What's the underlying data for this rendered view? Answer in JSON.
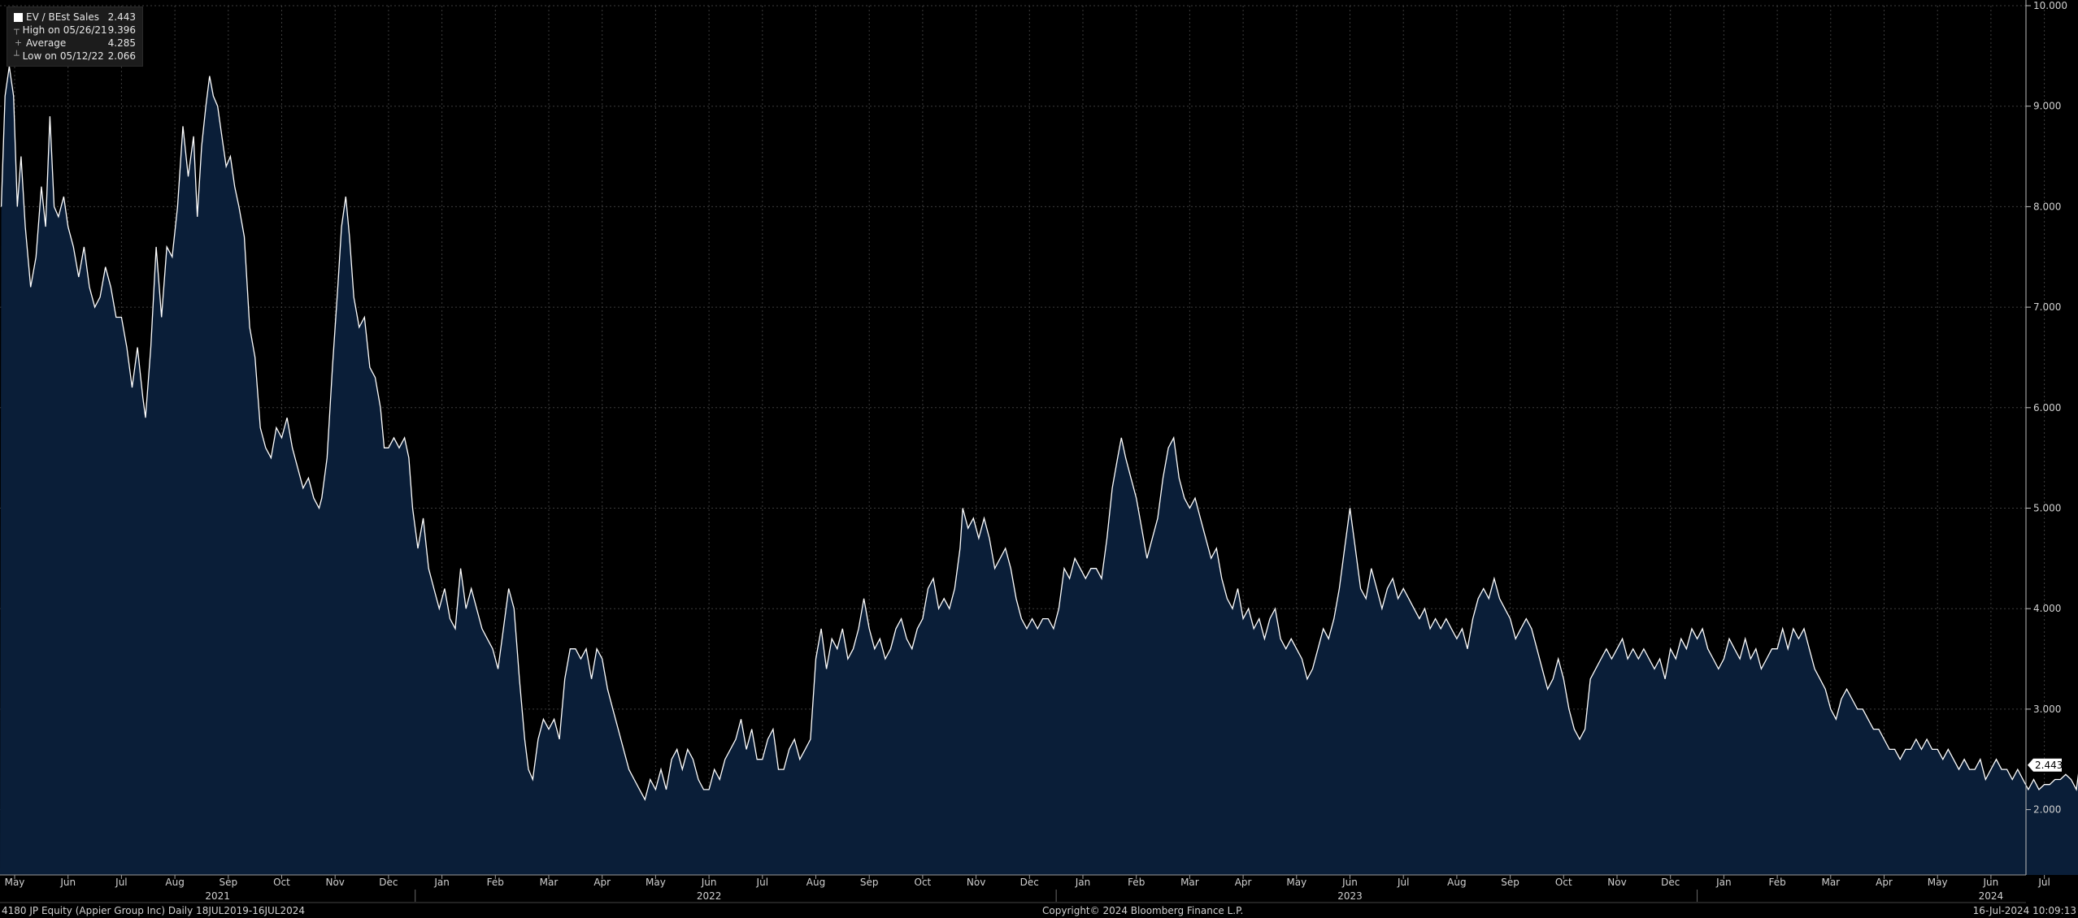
{
  "legend": {
    "items": [
      {
        "label": "EV / BEst Sales",
        "value": "2.443"
      },
      {
        "label": "High on 05/26/21",
        "value": "9.396"
      },
      {
        "label": "Average",
        "value": "4.285"
      },
      {
        "label": "Low on 05/12/22",
        "value": "2.066"
      }
    ]
  },
  "footer": {
    "left": "4180 JP Equity (Appier Group Inc)  Daily 18JUL2019-16JUL2024",
    "center": "Copyright© 2024 Bloomberg Finance L.P.",
    "right": "16-Jul-2024 10:09:13"
  },
  "last_value_label": "2.443",
  "colors": {
    "background": "#000000",
    "area": "#0a1e38",
    "line": "#ffffff",
    "grid": "#3c3c3c"
  },
  "chart_data": {
    "type": "area",
    "series": [
      {
        "name": "EV / BEst Sales"
      }
    ],
    "ylim": [
      1.35,
      10.0
    ],
    "y_ticks": [
      "2.000",
      "3.000",
      "4.000",
      "5.000",
      "6.000",
      "7.000",
      "8.000",
      "9.000",
      "10.000"
    ],
    "y_tick_values": [
      2,
      3,
      4,
      5,
      6,
      7,
      8,
      9,
      10
    ],
    "x_month_labels": [
      "May",
      "Jun",
      "Jul",
      "Aug",
      "Sep",
      "Oct",
      "Nov",
      "Dec",
      "Jan",
      "Feb",
      "Mar",
      "Apr",
      "May",
      "Jun",
      "Jul",
      "Aug",
      "Sep",
      "Oct",
      "Nov",
      "Dec",
      "Jan",
      "Feb",
      "Mar",
      "Apr",
      "May",
      "Jun",
      "Jul",
      "Aug",
      "Sep",
      "Oct",
      "Nov",
      "Dec",
      "Jan",
      "Feb",
      "Mar",
      "Apr",
      "May",
      "Jun",
      "Jul",
      "Aug",
      "Sep",
      "Oct",
      "Nov",
      "Dec",
      "Jan",
      "Feb",
      "Mar",
      "Apr",
      "May",
      "Jun",
      "Jul"
    ],
    "x_month_index": [
      0,
      1,
      2,
      3,
      4,
      5,
      6,
      7,
      8,
      9,
      10,
      11,
      12,
      13,
      14,
      15,
      16,
      17,
      18,
      19,
      20,
      21,
      22,
      23,
      24,
      25,
      26,
      27,
      28,
      29,
      30,
      31,
      32,
      33,
      34,
      35,
      36,
      37,
      38,
      39,
      40,
      41,
      42,
      43,
      44,
      45,
      46,
      47,
      48,
      49,
      50
    ],
    "x_year_labels": [
      {
        "label": "2021",
        "at_month_index": 3.8
      },
      {
        "label": "2022",
        "at_month_index": 13
      },
      {
        "label": "2023",
        "at_month_index": 25
      },
      {
        "label": "2024",
        "at_month_index": 37
      }
    ],
    "year_dividers_after_month_index": [
      7.5,
      19.5,
      31.5,
      43.5
    ],
    "points_by_month_index": [
      [
        -0.25,
        8.0
      ],
      [
        -0.18,
        9.1
      ],
      [
        -0.1,
        9.396
      ],
      [
        -0.02,
        9.1
      ],
      [
        0.05,
        8.0
      ],
      [
        0.12,
        8.5
      ],
      [
        0.2,
        7.8
      ],
      [
        0.3,
        7.2
      ],
      [
        0.4,
        7.5
      ],
      [
        0.5,
        8.2
      ],
      [
        0.58,
        7.8
      ],
      [
        0.66,
        8.9
      ],
      [
        0.74,
        8.0
      ],
      [
        0.82,
        7.9
      ],
      [
        0.92,
        8.1
      ],
      [
        1.0,
        7.8
      ],
      [
        1.1,
        7.6
      ],
      [
        1.2,
        7.3
      ],
      [
        1.3,
        7.6
      ],
      [
        1.4,
        7.2
      ],
      [
        1.5,
        7.0
      ],
      [
        1.6,
        7.1
      ],
      [
        1.7,
        7.4
      ],
      [
        1.8,
        7.2
      ],
      [
        1.9,
        6.9
      ],
      [
        2.0,
        6.9
      ],
      [
        2.1,
        6.6
      ],
      [
        2.2,
        6.2
      ],
      [
        2.3,
        6.6
      ],
      [
        2.4,
        6.1
      ],
      [
        2.45,
        5.9
      ],
      [
        2.55,
        6.6
      ],
      [
        2.65,
        7.6
      ],
      [
        2.75,
        6.9
      ],
      [
        2.85,
        7.6
      ],
      [
        2.95,
        7.5
      ],
      [
        3.05,
        8.0
      ],
      [
        3.15,
        8.8
      ],
      [
        3.25,
        8.3
      ],
      [
        3.35,
        8.7
      ],
      [
        3.42,
        7.9
      ],
      [
        3.5,
        8.6
      ],
      [
        3.58,
        9.0
      ],
      [
        3.65,
        9.3
      ],
      [
        3.72,
        9.1
      ],
      [
        3.8,
        9.0
      ],
      [
        3.88,
        8.7
      ],
      [
        3.96,
        8.4
      ],
      [
        4.04,
        8.5
      ],
      [
        4.12,
        8.2
      ],
      [
        4.2,
        8.0
      ],
      [
        4.3,
        7.7
      ],
      [
        4.4,
        6.8
      ],
      [
        4.5,
        6.5
      ],
      [
        4.6,
        5.8
      ],
      [
        4.7,
        5.6
      ],
      [
        4.8,
        5.5
      ],
      [
        4.9,
        5.8
      ],
      [
        5.0,
        5.7
      ],
      [
        5.1,
        5.9
      ],
      [
        5.2,
        5.6
      ],
      [
        5.3,
        5.4
      ],
      [
        5.4,
        5.2
      ],
      [
        5.5,
        5.3
      ],
      [
        5.6,
        5.1
      ],
      [
        5.7,
        5.0
      ],
      [
        5.75,
        5.1
      ],
      [
        5.85,
        5.5
      ],
      [
        5.95,
        6.4
      ],
      [
        6.05,
        7.2
      ],
      [
        6.12,
        7.8
      ],
      [
        6.2,
        8.1
      ],
      [
        6.27,
        7.7
      ],
      [
        6.35,
        7.1
      ],
      [
        6.45,
        6.8
      ],
      [
        6.55,
        6.9
      ],
      [
        6.65,
        6.4
      ],
      [
        6.75,
        6.3
      ],
      [
        6.85,
        6.0
      ],
      [
        6.92,
        5.6
      ],
      [
        7.0,
        5.6
      ],
      [
        7.1,
        5.7
      ],
      [
        7.2,
        5.6
      ],
      [
        7.3,
        5.7
      ],
      [
        7.38,
        5.5
      ],
      [
        7.45,
        5.0
      ],
      [
        7.55,
        4.6
      ],
      [
        7.65,
        4.9
      ],
      [
        7.75,
        4.4
      ],
      [
        7.85,
        4.2
      ],
      [
        7.95,
        4.0
      ],
      [
        8.05,
        4.2
      ],
      [
        8.15,
        3.9
      ],
      [
        8.25,
        3.8
      ],
      [
        8.35,
        4.4
      ],
      [
        8.45,
        4.0
      ],
      [
        8.55,
        4.2
      ],
      [
        8.65,
        4.0
      ],
      [
        8.75,
        3.8
      ],
      [
        8.85,
        3.7
      ],
      [
        8.95,
        3.6
      ],
      [
        9.05,
        3.4
      ],
      [
        9.15,
        3.8
      ],
      [
        9.25,
        4.2
      ],
      [
        9.35,
        4.0
      ],
      [
        9.45,
        3.3
      ],
      [
        9.55,
        2.7
      ],
      [
        9.62,
        2.4
      ],
      [
        9.7,
        2.3
      ],
      [
        9.8,
        2.7
      ],
      [
        9.9,
        2.9
      ],
      [
        10.0,
        2.8
      ],
      [
        10.1,
        2.9
      ],
      [
        10.2,
        2.7
      ],
      [
        10.3,
        3.3
      ],
      [
        10.4,
        3.6
      ],
      [
        10.5,
        3.6
      ],
      [
        10.6,
        3.5
      ],
      [
        10.7,
        3.6
      ],
      [
        10.8,
        3.3
      ],
      [
        10.9,
        3.6
      ],
      [
        11.0,
        3.5
      ],
      [
        11.1,
        3.2
      ],
      [
        11.2,
        3.0
      ],
      [
        11.3,
        2.8
      ],
      [
        11.4,
        2.6
      ],
      [
        11.5,
        2.4
      ],
      [
        11.6,
        2.3
      ],
      [
        11.7,
        2.2
      ],
      [
        11.8,
        2.1
      ],
      [
        11.9,
        2.3
      ],
      [
        12.0,
        2.2
      ],
      [
        12.1,
        2.4
      ],
      [
        12.2,
        2.2
      ],
      [
        12.3,
        2.5
      ],
      [
        12.4,
        2.6
      ],
      [
        12.5,
        2.4
      ],
      [
        12.6,
        2.6
      ],
      [
        12.7,
        2.5
      ],
      [
        12.8,
        2.3
      ],
      [
        12.9,
        2.2
      ],
      [
        13.0,
        2.2
      ],
      [
        13.1,
        2.4
      ],
      [
        13.2,
        2.3
      ],
      [
        13.3,
        2.5
      ],
      [
        13.4,
        2.6
      ],
      [
        13.5,
        2.7
      ],
      [
        13.6,
        2.9
      ],
      [
        13.7,
        2.6
      ],
      [
        13.8,
        2.8
      ],
      [
        13.9,
        2.5
      ],
      [
        14.0,
        2.5
      ],
      [
        14.1,
        2.7
      ],
      [
        14.2,
        2.8
      ],
      [
        14.3,
        2.4
      ],
      [
        14.4,
        2.4
      ],
      [
        14.5,
        2.6
      ],
      [
        14.6,
        2.7
      ],
      [
        14.7,
        2.5
      ],
      [
        14.8,
        2.6
      ],
      [
        14.9,
        2.7
      ],
      [
        15.0,
        3.5
      ],
      [
        15.1,
        3.8
      ],
      [
        15.2,
        3.4
      ],
      [
        15.3,
        3.7
      ],
      [
        15.4,
        3.6
      ],
      [
        15.5,
        3.8
      ],
      [
        15.6,
        3.5
      ],
      [
        15.7,
        3.6
      ],
      [
        15.8,
        3.8
      ],
      [
        15.9,
        4.1
      ],
      [
        16.0,
        3.8
      ],
      [
        16.1,
        3.6
      ],
      [
        16.2,
        3.7
      ],
      [
        16.3,
        3.5
      ],
      [
        16.4,
        3.6
      ],
      [
        16.5,
        3.8
      ],
      [
        16.6,
        3.9
      ],
      [
        16.7,
        3.7
      ],
      [
        16.8,
        3.6
      ],
      [
        16.9,
        3.8
      ],
      [
        17.0,
        3.9
      ],
      [
        17.1,
        4.2
      ],
      [
        17.2,
        4.3
      ],
      [
        17.3,
        4.0
      ],
      [
        17.4,
        4.1
      ],
      [
        17.5,
        4.0
      ],
      [
        17.6,
        4.2
      ],
      [
        17.7,
        4.6
      ],
      [
        17.75,
        5.0
      ],
      [
        17.85,
        4.8
      ],
      [
        17.95,
        4.9
      ],
      [
        18.05,
        4.7
      ],
      [
        18.15,
        4.9
      ],
      [
        18.25,
        4.7
      ],
      [
        18.35,
        4.4
      ],
      [
        18.45,
        4.5
      ],
      [
        18.55,
        4.6
      ],
      [
        18.65,
        4.4
      ],
      [
        18.75,
        4.1
      ],
      [
        18.85,
        3.9
      ],
      [
        18.95,
        3.8
      ],
      [
        19.05,
        3.9
      ],
      [
        19.15,
        3.8
      ],
      [
        19.25,
        3.9
      ],
      [
        19.35,
        3.9
      ],
      [
        19.45,
        3.8
      ],
      [
        19.55,
        4.0
      ],
      [
        19.65,
        4.4
      ],
      [
        19.75,
        4.3
      ],
      [
        19.85,
        4.5
      ],
      [
        19.95,
        4.4
      ],
      [
        20.05,
        4.3
      ],
      [
        20.15,
        4.4
      ],
      [
        20.25,
        4.4
      ],
      [
        20.35,
        4.3
      ],
      [
        20.45,
        4.7
      ],
      [
        20.55,
        5.2
      ],
      [
        20.65,
        5.5
      ],
      [
        20.72,
        5.7
      ],
      [
        20.8,
        5.5
      ],
      [
        20.9,
        5.3
      ],
      [
        21.0,
        5.1
      ],
      [
        21.1,
        4.8
      ],
      [
        21.2,
        4.5
      ],
      [
        21.3,
        4.7
      ],
      [
        21.4,
        4.9
      ],
      [
        21.5,
        5.3
      ],
      [
        21.6,
        5.6
      ],
      [
        21.7,
        5.7
      ],
      [
        21.8,
        5.3
      ],
      [
        21.9,
        5.1
      ],
      [
        22.0,
        5.0
      ],
      [
        22.1,
        5.1
      ],
      [
        22.2,
        4.9
      ],
      [
        22.3,
        4.7
      ],
      [
        22.4,
        4.5
      ],
      [
        22.5,
        4.6
      ],
      [
        22.6,
        4.3
      ],
      [
        22.7,
        4.1
      ],
      [
        22.8,
        4.0
      ],
      [
        22.9,
        4.2
      ],
      [
        23.0,
        3.9
      ],
      [
        23.1,
        4.0
      ],
      [
        23.2,
        3.8
      ],
      [
        23.3,
        3.9
      ],
      [
        23.4,
        3.7
      ],
      [
        23.5,
        3.9
      ],
      [
        23.6,
        4.0
      ],
      [
        23.7,
        3.7
      ],
      [
        23.8,
        3.6
      ],
      [
        23.9,
        3.7
      ],
      [
        24.0,
        3.6
      ],
      [
        24.1,
        3.5
      ],
      [
        24.2,
        3.3
      ],
      [
        24.3,
        3.4
      ],
      [
        24.4,
        3.6
      ],
      [
        24.5,
        3.8
      ],
      [
        24.6,
        3.7
      ],
      [
        24.7,
        3.9
      ],
      [
        24.8,
        4.2
      ],
      [
        24.9,
        4.6
      ],
      [
        25.0,
        5.0
      ],
      [
        25.1,
        4.6
      ],
      [
        25.2,
        4.2
      ],
      [
        25.3,
        4.1
      ],
      [
        25.4,
        4.4
      ],
      [
        25.5,
        4.2
      ],
      [
        25.6,
        4.0
      ],
      [
        25.7,
        4.2
      ],
      [
        25.8,
        4.3
      ],
      [
        25.9,
        4.1
      ],
      [
        26.0,
        4.2
      ],
      [
        26.1,
        4.1
      ],
      [
        26.2,
        4.0
      ],
      [
        26.3,
        3.9
      ],
      [
        26.4,
        4.0
      ],
      [
        26.5,
        3.8
      ],
      [
        26.6,
        3.9
      ],
      [
        26.7,
        3.8
      ],
      [
        26.8,
        3.9
      ],
      [
        26.9,
        3.8
      ],
      [
        27.0,
        3.7
      ],
      [
        27.1,
        3.8
      ],
      [
        27.2,
        3.6
      ],
      [
        27.3,
        3.9
      ],
      [
        27.4,
        4.1
      ],
      [
        27.5,
        4.2
      ],
      [
        27.6,
        4.1
      ],
      [
        27.7,
        4.3
      ],
      [
        27.8,
        4.1
      ],
      [
        27.9,
        4.0
      ],
      [
        28.0,
        3.9
      ],
      [
        28.1,
        3.7
      ],
      [
        28.2,
        3.8
      ],
      [
        28.3,
        3.9
      ],
      [
        28.4,
        3.8
      ],
      [
        28.5,
        3.6
      ],
      [
        28.6,
        3.4
      ],
      [
        28.7,
        3.2
      ],
      [
        28.8,
        3.3
      ],
      [
        28.9,
        3.5
      ],
      [
        29.0,
        3.3
      ],
      [
        29.1,
        3.0
      ],
      [
        29.2,
        2.8
      ],
      [
        29.3,
        2.7
      ],
      [
        29.4,
        2.8
      ],
      [
        29.5,
        3.3
      ],
      [
        29.6,
        3.4
      ],
      [
        29.7,
        3.5
      ],
      [
        29.8,
        3.6
      ],
      [
        29.9,
        3.5
      ],
      [
        30.0,
        3.6
      ],
      [
        30.1,
        3.7
      ],
      [
        30.2,
        3.5
      ],
      [
        30.3,
        3.6
      ],
      [
        30.4,
        3.5
      ],
      [
        30.5,
        3.6
      ],
      [
        30.6,
        3.5
      ],
      [
        30.7,
        3.4
      ],
      [
        30.8,
        3.5
      ],
      [
        30.9,
        3.3
      ],
      [
        31.0,
        3.6
      ],
      [
        31.1,
        3.5
      ],
      [
        31.2,
        3.7
      ],
      [
        31.3,
        3.6
      ],
      [
        31.4,
        3.8
      ],
      [
        31.5,
        3.7
      ],
      [
        31.6,
        3.8
      ],
      [
        31.7,
        3.6
      ],
      [
        31.8,
        3.5
      ],
      [
        31.9,
        3.4
      ],
      [
        32.0,
        3.5
      ],
      [
        32.1,
        3.7
      ],
      [
        32.2,
        3.6
      ],
      [
        32.3,
        3.5
      ],
      [
        32.4,
        3.7
      ],
      [
        32.5,
        3.5
      ],
      [
        32.6,
        3.6
      ],
      [
        32.7,
        3.4
      ],
      [
        32.8,
        3.5
      ],
      [
        32.9,
        3.6
      ],
      [
        33.0,
        3.6
      ],
      [
        33.1,
        3.8
      ],
      [
        33.2,
        3.6
      ],
      [
        33.3,
        3.8
      ],
      [
        33.4,
        3.7
      ],
      [
        33.5,
        3.8
      ],
      [
        33.6,
        3.6
      ],
      [
        33.7,
        3.4
      ],
      [
        33.8,
        3.3
      ],
      [
        33.9,
        3.2
      ],
      [
        34.0,
        3.0
      ],
      [
        34.1,
        2.9
      ],
      [
        34.2,
        3.1
      ],
      [
        34.3,
        3.2
      ],
      [
        34.4,
        3.1
      ],
      [
        34.5,
        3.0
      ],
      [
        34.6,
        3.0
      ],
      [
        34.7,
        2.9
      ],
      [
        34.8,
        2.8
      ],
      [
        34.9,
        2.8
      ],
      [
        35.0,
        2.7
      ],
      [
        35.1,
        2.6
      ],
      [
        35.2,
        2.6
      ],
      [
        35.3,
        2.5
      ],
      [
        35.4,
        2.6
      ],
      [
        35.5,
        2.6
      ],
      [
        35.6,
        2.7
      ],
      [
        35.7,
        2.6
      ],
      [
        35.8,
        2.7
      ],
      [
        35.9,
        2.6
      ],
      [
        36.0,
        2.6
      ],
      [
        36.1,
        2.5
      ],
      [
        36.2,
        2.6
      ],
      [
        36.3,
        2.5
      ],
      [
        36.4,
        2.4
      ],
      [
        36.5,
        2.5
      ],
      [
        36.6,
        2.4
      ],
      [
        36.7,
        2.4
      ],
      [
        36.8,
        2.5
      ],
      [
        36.9,
        2.3
      ],
      [
        37.0,
        2.4
      ],
      [
        37.1,
        2.5
      ],
      [
        37.2,
        2.4
      ],
      [
        37.3,
        2.4
      ],
      [
        37.4,
        2.3
      ],
      [
        37.5,
        2.4
      ],
      [
        37.6,
        2.3
      ],
      [
        37.7,
        2.2
      ],
      [
        37.8,
        2.3
      ],
      [
        37.9,
        2.2
      ],
      [
        38.0,
        2.25
      ],
      [
        38.1,
        2.25
      ],
      [
        38.2,
        2.3
      ],
      [
        38.3,
        2.3
      ],
      [
        38.4,
        2.35
      ],
      [
        38.5,
        2.3
      ],
      [
        38.6,
        2.2
      ],
      [
        38.66,
        2.443
      ]
    ]
  }
}
